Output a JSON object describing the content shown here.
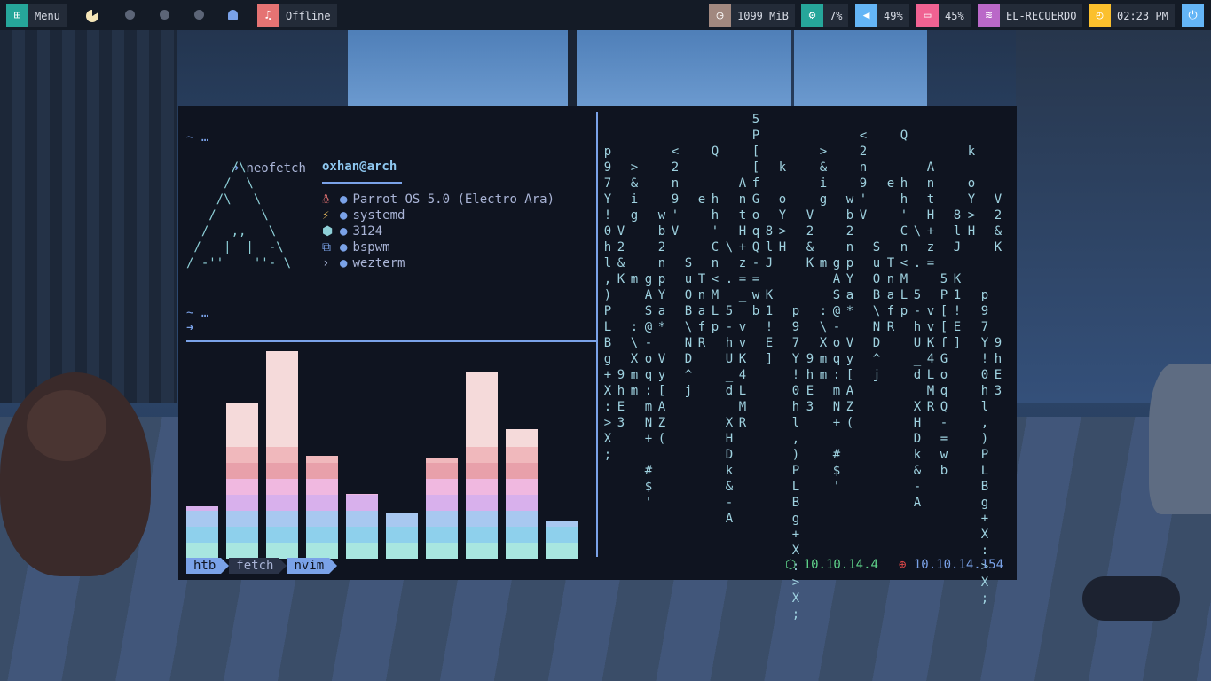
{
  "topbar": {
    "menu_label": "Menu",
    "offline_label": "Offline",
    "memory": "1099 MiB",
    "cpu": "7%",
    "volume": "49%",
    "battery": "45%",
    "wifi": "EL-RECUERDO",
    "clock": "02:23 PM"
  },
  "colors": {
    "menu": "#26a69a",
    "music": "#e57373",
    "memory": "#a1887f",
    "cpu": "#26a69a",
    "volume": "#64b5f6",
    "battery": "#f06292",
    "wifi": "#ba68c8",
    "clock": "#fbc02d",
    "power": "#64b5f6",
    "accent": "#7aa2e8"
  },
  "terminal": {
    "prompt_path": "~ …",
    "prompt_arrow": "➜",
    "command": "neofetch",
    "user_host": "oxhan@arch",
    "info": [
      {
        "icon": "penguin-icon",
        "value": "Parrot OS 5.0 (Electro Ara)"
      },
      {
        "icon": "lightning-icon",
        "value": "systemd"
      },
      {
        "icon": "package-icon",
        "value": "3124"
      },
      {
        "icon": "windows-icon",
        "value": "bspwm"
      },
      {
        "icon": "terminal-icon",
        "value": "wezterm"
      }
    ],
    "tabs": [
      "htb",
      "fetch",
      "nvim"
    ],
    "ip_local": "10.10.14.4",
    "ip_target": "10.10.14.154"
  },
  "cava": {
    "bars": [
      0.25,
      0.74,
      0.99,
      0.49,
      0.31,
      0.22,
      0.48,
      0.89,
      0.62,
      0.18
    ],
    "palette": [
      "#f5dada",
      "#f0b8bc",
      "#e8a0aa",
      "#f0b8e0",
      "#d8b0ec",
      "#a8c8f0",
      "#8ed0ec",
      "#a8e6e0"
    ]
  },
  "matrix_columns": [
    "  p97Y!0hl,)PLBg+X:>X;",
    "V2&K     9hE3",
    ">&ig   m  :\\Xmm",
    "gAS@-oq:mN+ #$'",
    "wb2npYa* Vy[AZ(",
    "<2n9'V",
    "SuOB\\ND^j",
    "e    TnafR",
    " Q  hh'Cn<MLp",
    "\\ . 5-hU_d XHDk&-A",
    "AntH+z=_ vvK4LMR",
    "5P[[fGoqQ-=wb",
    "8lJ K1!E]",
    "k oY>H"
  ]
}
